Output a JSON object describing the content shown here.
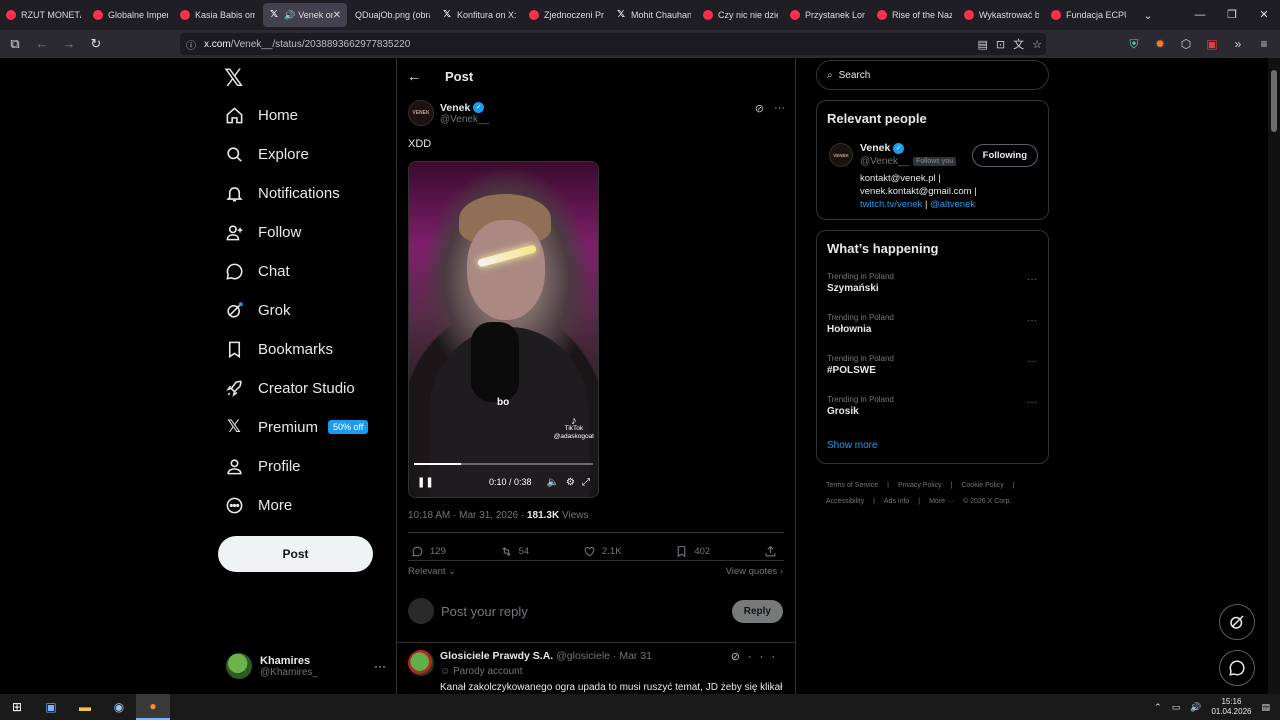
{
  "browser": {
    "tabs": [
      {
        "title": "RZUT MONETĄ",
        "icon": "youtube"
      },
      {
        "title": "Globalne Imperi",
        "icon": "youtube"
      },
      {
        "title": "Kasia Babis oma",
        "icon": "youtube"
      },
      {
        "title": "Venek on",
        "icon": "x",
        "active": true
      },
      {
        "title": "QDuajOb.png (obraz",
        "icon": "image"
      },
      {
        "title": "Konfitura on X: \"",
        "icon": "x"
      },
      {
        "title": "Zjednoczeni Prze",
        "icon": "youtube"
      },
      {
        "title": "Mohit Chauhan",
        "icon": "x"
      },
      {
        "title": "Czy nic nie dziej",
        "icon": "youtube"
      },
      {
        "title": "Przystanek Lomb",
        "icon": "youtube"
      },
      {
        "title": "Rise of the Nazis",
        "icon": "youtube"
      },
      {
        "title": "Wykastrować be",
        "icon": "youtube"
      },
      {
        "title": "Fundacja ECPU P",
        "icon": "youtube"
      }
    ],
    "url_host": "x.com",
    "url_path": "/Venek__/status/2038893662977835220",
    "window_controls": [
      "minimize",
      "restore",
      "close"
    ]
  },
  "sidebar": {
    "items": [
      {
        "label": "Home",
        "icon": "home-icon"
      },
      {
        "label": "Explore",
        "icon": "search-icon"
      },
      {
        "label": "Notifications",
        "icon": "bell-icon"
      },
      {
        "label": "Follow",
        "icon": "person-add-icon"
      },
      {
        "label": "Chat",
        "icon": "chat-bubble-icon"
      },
      {
        "label": "Grok",
        "icon": "grok-icon"
      },
      {
        "label": "Bookmarks",
        "icon": "bookmark-icon"
      },
      {
        "label": "Creator Studio",
        "icon": "rocket-icon"
      },
      {
        "label": "Premium",
        "icon": "x-logo-icon",
        "badge": "50% off"
      },
      {
        "label": "Profile",
        "icon": "person-icon"
      },
      {
        "label": "More",
        "icon": "more-circle-icon"
      }
    ],
    "post_button": "Post",
    "account": {
      "name": "Khamires",
      "handle": "@Khamires_"
    }
  },
  "post": {
    "header_title": "Post",
    "author_name": "Venek",
    "author_handle": "@Venek__",
    "avatar_text": "VENEK",
    "text": "XDD",
    "video": {
      "time": "0:10 / 0:38",
      "progress": 0.26,
      "overlay_text": "bo",
      "watermark_brand": "TikTok",
      "watermark_handle": "@adaskogoat"
    },
    "timestamp": "10:18 AM · Mar 31, 2026 · ",
    "views_count": "181.3K",
    "views_label": " Views",
    "stats": {
      "replies": "129",
      "reposts": "54",
      "likes": "2.1K",
      "bookmarks": "402"
    },
    "sort_label": "Relevant",
    "view_quotes": "View quotes",
    "reply_placeholder": "Post your reply",
    "reply_button": "Reply"
  },
  "reply": {
    "name": "Glosiciele Prawdy S.A.",
    "handle": "@glosiciele",
    "date": "· Mar 31",
    "label": "Parody account",
    "text": "Kanał zakolczykowanego ogra upada to musi ruszyć temat, JD żeby się klikał"
  },
  "right": {
    "search_placeholder": "Search",
    "relevant_title": "Relevant people",
    "person": {
      "name": "Venek",
      "handle": "@Venek__",
      "follows_you": "Follows you",
      "follow_button": "Following",
      "bio_plain": "kontakt@venek.pl | venek.kontakt@gmail.com | ",
      "bio_link1": "twitch.tv/venek",
      "bio_sep": " | ",
      "bio_link2": "@altvenek"
    },
    "happening_title": "What’s happening",
    "trends": [
      {
        "category": "Trending in Poland",
        "title": "Szymański"
      },
      {
        "category": "Trending in Poland",
        "title": "Hołownia"
      },
      {
        "category": "Trending in Poland",
        "title": "#POLSWE"
      },
      {
        "category": "Trending in Poland",
        "title": "Grosik"
      }
    ],
    "show_more": "Show more",
    "footer": [
      "Terms of Service",
      "|",
      "Privacy Policy",
      "|",
      "Cookie Policy",
      "|",
      "Accessibility",
      "|",
      "Ads info",
      "|",
      "More ···",
      "© 2026 X Corp."
    ]
  },
  "taskbar": {
    "time": "15:16",
    "date": "01.04.2026"
  }
}
